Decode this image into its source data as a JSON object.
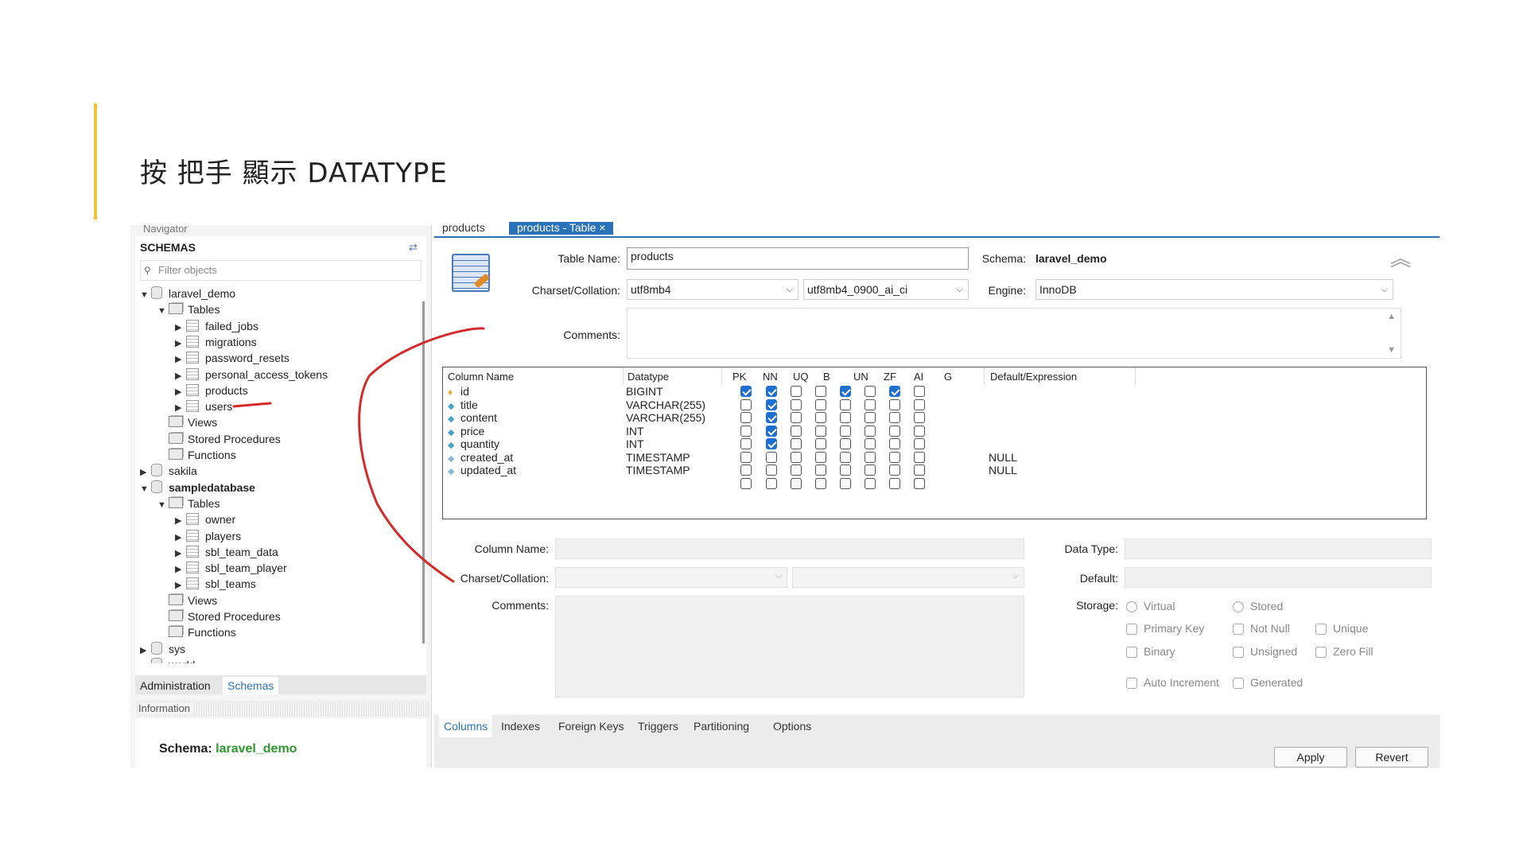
{
  "slide": {
    "title": "按 把手 顯示 DATATYPE"
  },
  "navigator": {
    "header": "Navigator",
    "schemas_label": "SCHEMAS",
    "filter_placeholder": "Filter objects",
    "tree": [
      {
        "label": "laravel_demo",
        "toggle": "▼"
      },
      {
        "label": "Tables",
        "toggle": "▼"
      },
      {
        "label": "failed_jobs",
        "toggle": "▶"
      },
      {
        "label": "migrations",
        "toggle": "▶"
      },
      {
        "label": "password_resets",
        "toggle": "▶"
      },
      {
        "label": "personal_access_tokens",
        "toggle": "▶"
      },
      {
        "label": "products",
        "toggle": "▶"
      },
      {
        "label": "users",
        "toggle": "▶"
      },
      {
        "label": "Views",
        "toggle": ""
      },
      {
        "label": "Stored Procedures",
        "toggle": ""
      },
      {
        "label": "Functions",
        "toggle": ""
      },
      {
        "label": "sakila",
        "toggle": "▶"
      },
      {
        "label": "sampledatabase",
        "toggle": "▼"
      },
      {
        "label": "Tables",
        "toggle": "▼"
      },
      {
        "label": "owner",
        "toggle": "▶"
      },
      {
        "label": "players",
        "toggle": "▶"
      },
      {
        "label": "sbl_team_data",
        "toggle": "▶"
      },
      {
        "label": "sbl_team_player",
        "toggle": "▶"
      },
      {
        "label": "sbl_teams",
        "toggle": "▶"
      },
      {
        "label": "Views",
        "toggle": ""
      },
      {
        "label": "Stored Procedures",
        "toggle": ""
      },
      {
        "label": "Functions",
        "toggle": ""
      },
      {
        "label": "sys",
        "toggle": "▶"
      },
      {
        "label": "world",
        "toggle": "▶"
      }
    ],
    "tabs": [
      "Administration",
      "Schemas"
    ],
    "info_header": "Information",
    "schema_info_label": "Schema:",
    "schema_info_value": "laravel_demo"
  },
  "editor": {
    "tabs": [
      "products",
      "products - Table"
    ],
    "tab_close": "×",
    "table_name_label": "Table Name:",
    "table_name_value": "products",
    "schema_label": "Schema:",
    "schema_value": "laravel_demo",
    "charset_label": "Charset/Collation:",
    "charset_value": "utf8mb4",
    "collation_value": "utf8mb4_0900_ai_ci",
    "engine_label": "Engine:",
    "engine_value": "InnoDB",
    "comments_label": "Comments:",
    "grid": {
      "headers": [
        "Column Name",
        "Datatype",
        "PK",
        "NN",
        "UQ",
        "B",
        "UN",
        "ZF",
        "AI",
        "G",
        "Default/Expression"
      ],
      "rows": [
        {
          "name": "id",
          "type": "BIGINT",
          "flags": [
            1,
            1,
            0,
            0,
            1,
            0,
            1,
            0
          ],
          "default": "",
          "key": true
        },
        {
          "name": "title",
          "type": "VARCHAR(255)",
          "flags": [
            0,
            1,
            0,
            0,
            0,
            0,
            0,
            0
          ],
          "default": "",
          "key": false
        },
        {
          "name": "content",
          "type": "VARCHAR(255)",
          "flags": [
            0,
            1,
            0,
            0,
            0,
            0,
            0,
            0
          ],
          "default": "",
          "key": false
        },
        {
          "name": "price",
          "type": "INT",
          "flags": [
            0,
            1,
            0,
            0,
            0,
            0,
            0,
            0
          ],
          "default": "",
          "key": false
        },
        {
          "name": "quantity",
          "type": "INT",
          "flags": [
            0,
            1,
            0,
            0,
            0,
            0,
            0,
            0
          ],
          "default": "",
          "key": false
        },
        {
          "name": "created_at",
          "type": "TIMESTAMP",
          "flags": [
            0,
            0,
            0,
            0,
            0,
            0,
            0,
            0
          ],
          "default": "NULL",
          "key": false
        },
        {
          "name": "updated_at",
          "type": "TIMESTAMP",
          "flags": [
            0,
            0,
            0,
            0,
            0,
            0,
            0,
            0
          ],
          "default": "NULL",
          "key": false
        },
        {
          "name": "",
          "type": "",
          "flags": [
            0,
            0,
            0,
            0,
            0,
            0,
            0,
            0
          ],
          "default": "",
          "key": false
        }
      ]
    },
    "detail": {
      "column_name_label": "Column Name:",
      "data_type_label": "Data Type:",
      "charset_label": "Charset/Collation:",
      "default_label": "Default:",
      "comments_label": "Comments:",
      "storage_label": "Storage:",
      "virtual": "Virtual",
      "stored": "Stored",
      "primary_key": "Primary Key",
      "not_null": "Not Null",
      "unique": "Unique",
      "binary": "Binary",
      "unsigned": "Unsigned",
      "zero_fill": "Zero Fill",
      "auto_increment": "Auto Increment",
      "generated": "Generated"
    },
    "bottom_tabs": [
      "Columns",
      "Indexes",
      "Foreign Keys",
      "Triggers",
      "Partitioning",
      "Options"
    ],
    "apply": "Apply",
    "revert": "Revert"
  },
  "colors": {
    "accent": "#2a72b8",
    "title_bar": "#f2c233",
    "annotation": "#d42a2a",
    "schema_value": "#2e9a2e"
  }
}
